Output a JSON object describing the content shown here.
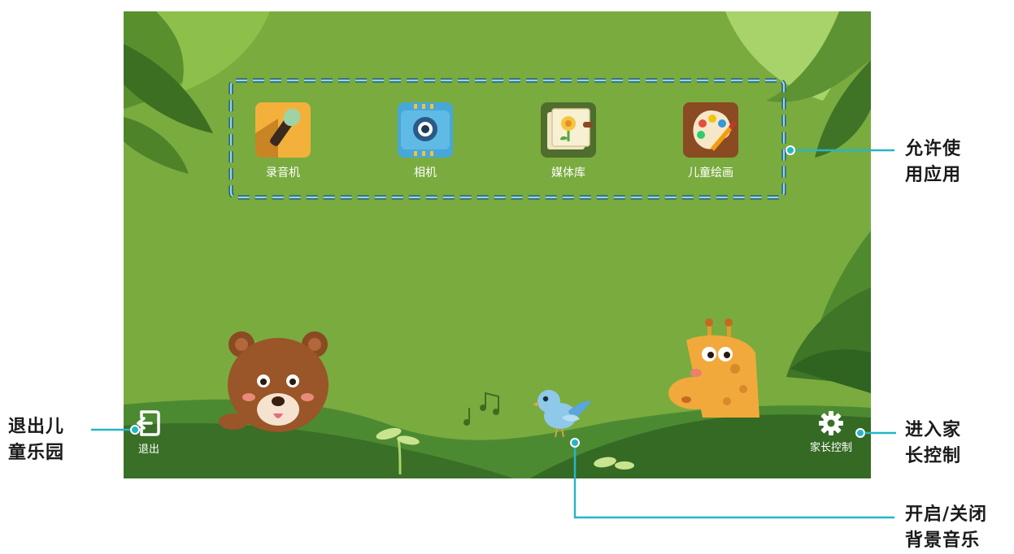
{
  "apps": [
    {
      "label": "录音机",
      "icon": "microphone-icon"
    },
    {
      "label": "相机",
      "icon": "camera-icon"
    },
    {
      "label": "媒体库",
      "icon": "gallery-icon"
    },
    {
      "label": "儿童绘画",
      "icon": "paint-palette-icon"
    }
  ],
  "exit": {
    "label": "退出",
    "icon": "exit-door-icon"
  },
  "parental": {
    "label": "家长控制",
    "icon": "gear-icon"
  },
  "music_toggle": {
    "icon": "bird-icon"
  },
  "callouts": {
    "allowed_apps": [
      "允许使",
      "用应用"
    ],
    "exit_kids": [
      "退出儿",
      "童乐园"
    ],
    "parental": [
      "进入家",
      "长控制"
    ],
    "music": [
      "开启/关闭",
      "背景音乐"
    ]
  },
  "colors": {
    "callout_line": "#26b6c6",
    "background": "#7aab3f",
    "hill": "#3f7a2c"
  }
}
